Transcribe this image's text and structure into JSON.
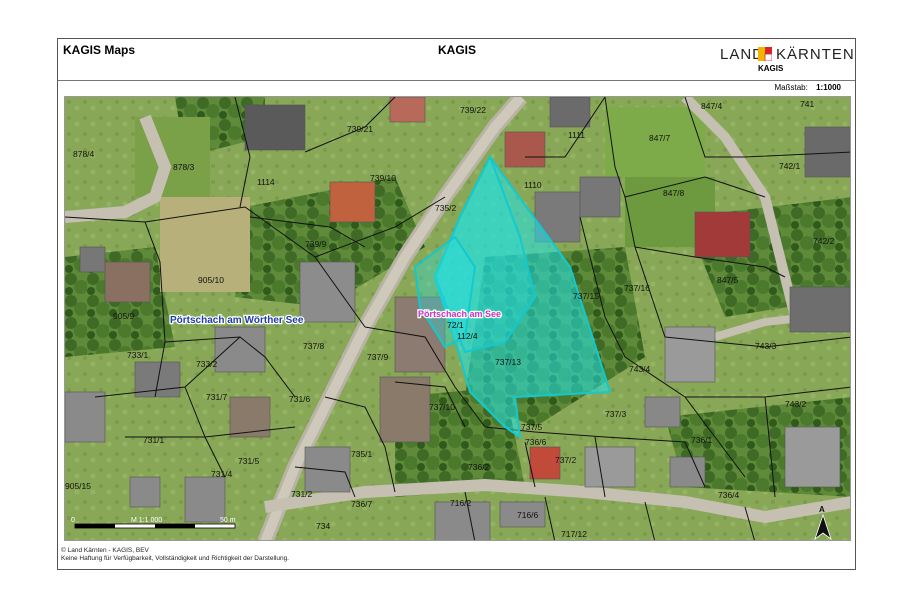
{
  "header": {
    "app_title": "KAGIS Maps",
    "center_title": "KAGIS",
    "logo": {
      "left_word": "LAND",
      "right_word": "KÄRNTEN",
      "sub_label": "KAGIS"
    }
  },
  "scale": {
    "label": "Maßstab:",
    "value": "1:1000"
  },
  "map": {
    "place_label": "Pörtschach am Wörther See",
    "highlight_label": "Pörtschach am See",
    "highlight_parcels": [
      "72/1",
      "112/4",
      "737/13"
    ],
    "scalebar": {
      "start": "0",
      "mid": "M 1:1 000",
      "end": "50 m"
    },
    "north_arrow": "A",
    "parcels": [
      "878/4",
      "878/3",
      "1114",
      "739/21",
      "739/22",
      "847/4",
      "741",
      "1111",
      "847/7",
      "739/10",
      "1110",
      "847/8",
      "742/1",
      "735/2",
      "739/9",
      "742/2",
      "905/10",
      "847/5",
      "737/16",
      "737/15",
      "905/9",
      "733/1",
      "733/2",
      "737/8",
      "737/9",
      "743/3",
      "743/4",
      "731/7",
      "731/6",
      "737/10",
      "737/5",
      "737/3",
      "731/1",
      "736/6",
      "735/1",
      "736/1",
      "743/2",
      "731/5",
      "731/4",
      "737/2",
      "736/2",
      "905/15",
      "731/2",
      "736/4",
      "736/7",
      "716/2",
      "716/6",
      "717/12",
      "734"
    ],
    "colors": {
      "highlight_fill": "#1fe3e8",
      "highlight_stroke": "#12c9d0",
      "place_label": "#1e3ea8",
      "highlight_label": "#c732c7"
    }
  },
  "footer": {
    "line1": "© Land Kärnten - KAGIS, BEV",
    "line2": "Keine Haftung für Verfügbarkeit, Vollständigkeit und Richtigkeit der Darstellung."
  }
}
